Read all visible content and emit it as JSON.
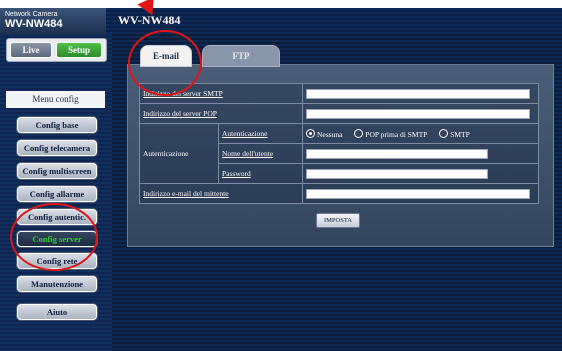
{
  "brand": {
    "small": "Network Camera",
    "model": "WV-NW484"
  },
  "header": {
    "title": "WV-NW484"
  },
  "nav": {
    "live": "Live",
    "setup": "Setup"
  },
  "sidebar": {
    "menu_title": "Menu config",
    "items": [
      {
        "label": "Config base"
      },
      {
        "label": "Config telecamera"
      },
      {
        "label": "Config multiscreen"
      },
      {
        "label": "Config allarme"
      },
      {
        "label": "Config autentic."
      },
      {
        "label": "Config server"
      },
      {
        "label": "Config rete"
      },
      {
        "label": "Manutenzione"
      },
      {
        "label": "Aiuto"
      }
    ]
  },
  "tabs": [
    {
      "label": "E-mail"
    },
    {
      "label": "FTP"
    }
  ],
  "form": {
    "smtp_label": "Indirizzo del server SMTP",
    "smtp_value": "",
    "pop_label": "Indirizzo del server POP",
    "pop_value": "",
    "auth_group_label": "Autenticazione",
    "auth_label": "Autenticazione",
    "auth_options": [
      "Nessuna",
      "POP prima di SMTP",
      "SMTP"
    ],
    "auth_selected": "Nessuna",
    "user_label": "Nome dell'utente",
    "user_value": "",
    "password_label": "Password",
    "password_value": "",
    "sender_label": "Indirizzo e-mail del mittente",
    "sender_value": "",
    "submit_label": "IMPOSTA"
  },
  "colors": {
    "active_menu_text": "#2ed42e",
    "annotation": "#e01515",
    "setup_green": "#3aa936"
  }
}
